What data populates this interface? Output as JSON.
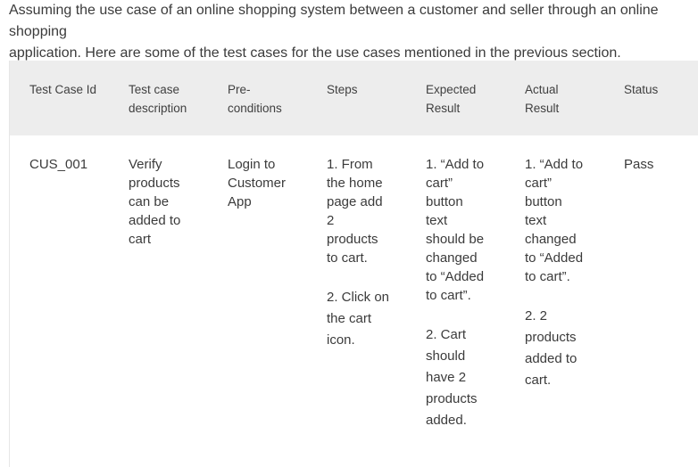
{
  "intro": {
    "line1": "Assuming the use case of an online shopping system between a customer and seller through an online shopping",
    "line2": "application. Here are some of the test cases for the use cases mentioned in the previous section."
  },
  "table": {
    "headers": {
      "test_case_id": "Test Case Id",
      "description_1": "Test case",
      "description_2": "description",
      "preconditions_1": "Pre-",
      "preconditions_2": "conditions",
      "steps": "Steps",
      "expected_1": "Expected",
      "expected_2": "Result",
      "actual_1": "Actual",
      "actual_2": "Result",
      "status": "Status"
    },
    "rows": [
      {
        "test_case_id": "CUS_001",
        "description": [
          "Verify",
          "products",
          "can be",
          "added to",
          "cart"
        ],
        "preconditions": [
          "Login to",
          "Customer",
          "App"
        ],
        "steps_1": [
          "1. From",
          "the home",
          "page add",
          "2",
          "products",
          "to cart."
        ],
        "steps_2": [
          "2. Click on",
          "the cart",
          "icon."
        ],
        "expected_1": [
          "1. “Add to",
          "cart”",
          "button",
          "text",
          "should be",
          "changed",
          "to “Added",
          "to cart”."
        ],
        "expected_2": [
          "2. Cart",
          "should",
          "have 2",
          "products",
          "added."
        ],
        "actual_1": [
          "1. “Add to",
          "cart”",
          "button",
          "text",
          "changed",
          "to “Added",
          "to cart”."
        ],
        "actual_2": [
          "2. 2",
          "products",
          "added to",
          "cart."
        ],
        "status": "Pass"
      }
    ]
  }
}
